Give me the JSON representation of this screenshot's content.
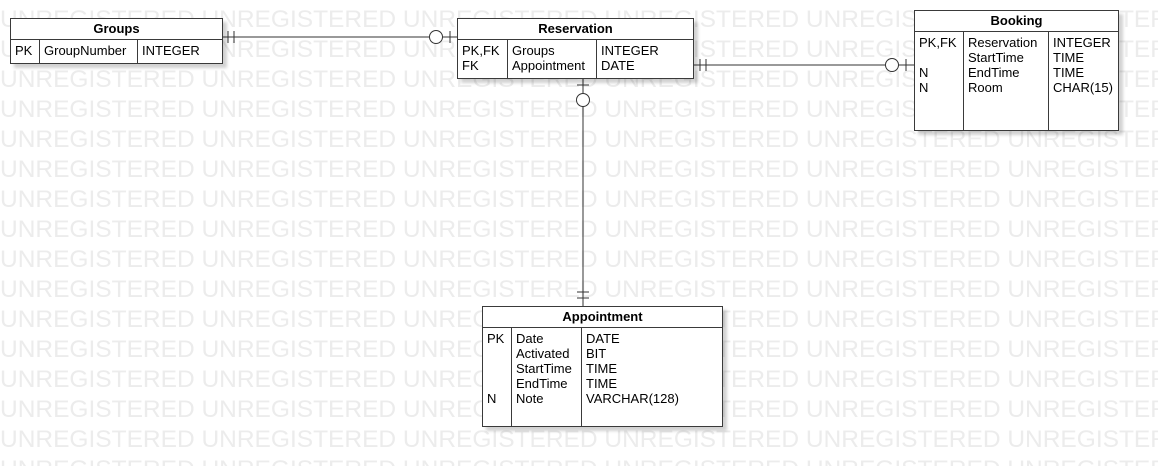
{
  "watermark": "UNREGISTERED",
  "entities": {
    "groups": {
      "title": "Groups",
      "rows": [
        {
          "key": "PK",
          "name": "GroupNumber",
          "type": "INTEGER"
        }
      ]
    },
    "reservation": {
      "title": "Reservation",
      "rows": [
        {
          "key": "PK,FK",
          "name": "Groups",
          "type": "INTEGER"
        },
        {
          "key": "FK",
          "name": "Appointment",
          "type": "DATE"
        }
      ]
    },
    "booking": {
      "title": "Booking",
      "rows": [
        {
          "key": "PK,FK",
          "name": "Reservation",
          "type": "INTEGER"
        },
        {
          "key": "",
          "name": "StartTime",
          "type": "TIME"
        },
        {
          "key": "N",
          "name": "EndTime",
          "type": "TIME"
        },
        {
          "key": "N",
          "name": "Room",
          "type": "CHAR(15)"
        }
      ]
    },
    "appointment": {
      "title": "Appointment",
      "rows": [
        {
          "key": "PK",
          "name": "Date",
          "type": "DATE"
        },
        {
          "key": "",
          "name": "Activated",
          "type": "BIT"
        },
        {
          "key": "",
          "name": "StartTime",
          "type": "TIME"
        },
        {
          "key": "",
          "name": "EndTime",
          "type": "TIME"
        },
        {
          "key": "N",
          "name": "Note",
          "type": "VARCHAR(128)"
        }
      ]
    }
  },
  "relationships": [
    {
      "from": "groups",
      "to": "reservation",
      "from_end": "one-and-only-one",
      "to_end": "zero-or-one"
    },
    {
      "from": "reservation",
      "to": "booking",
      "from_end": "one-and-only-one",
      "to_end": "zero-or-one"
    },
    {
      "from": "reservation",
      "to": "appointment",
      "from_end": "zero-or-one",
      "to_end": "one-and-only-one"
    }
  ]
}
